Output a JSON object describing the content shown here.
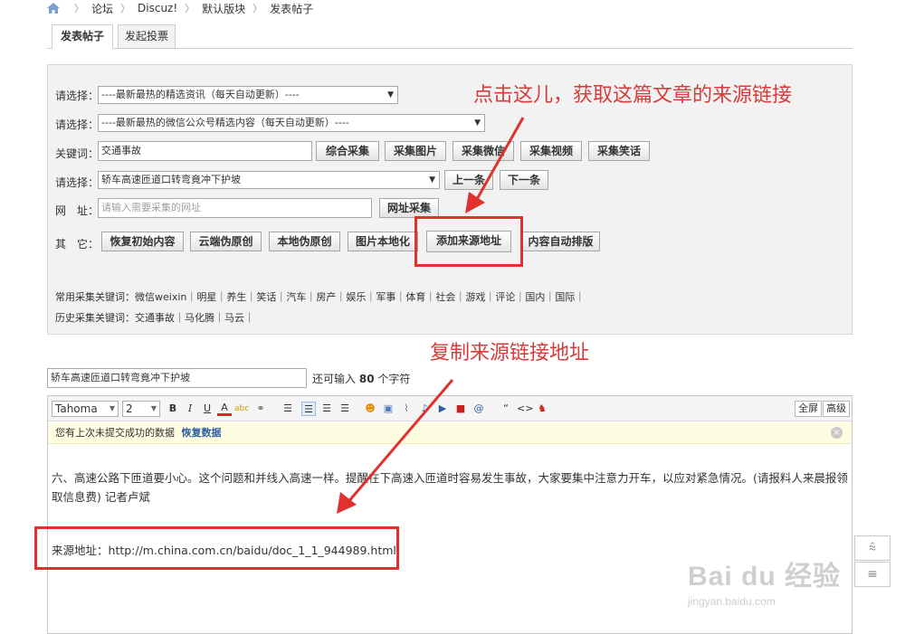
{
  "breadcrumb": {
    "items": [
      "论坛",
      "Discuz!",
      "默认版块",
      "发表帖子"
    ]
  },
  "tabs": [
    {
      "label": "发表帖子"
    },
    {
      "label": "发起投票"
    }
  ],
  "panel": {
    "row1": {
      "label": "请选择：",
      "value": "----最新最热的精选资讯（每天自动更新）----"
    },
    "row2": {
      "label": "请选择：",
      "value": "----最新最热的微信公众号精选内容（每天自动更新）----"
    },
    "row3": {
      "label": "关键词：",
      "value": "交通事故",
      "buttons": [
        "综合采集",
        "采集图片",
        "采集微信",
        "采集视频",
        "采集笑话"
      ]
    },
    "row4": {
      "label": "请选择：",
      "value": "轿车高速匝道口转弯竟冲下护坡",
      "buttons": [
        "上一条",
        "下一条"
      ]
    },
    "row5": {
      "label": "网　址：",
      "placeholder": "请输入需要采集的网址",
      "button": "网址采集"
    },
    "row6": {
      "label": "其　它：",
      "buttons": [
        "恢复初始内容",
        "云端伪原创",
        "本地伪原创",
        "图片本地化",
        "添加来源地址",
        "内容自动排版"
      ]
    },
    "keywords_common": "常用采集关键词：微信weixin｜明星｜养生｜笑话｜汽车｜房产｜娱乐｜军事｜体育｜社会｜游戏｜评论｜国内｜国际｜",
    "keywords_history": "历史采集关键词：交通事故｜马化腾｜马云｜"
  },
  "title": {
    "value": "轿车高速匝道口转弯竟冲下护坡",
    "count_prefix": "还可输入",
    "count_value": "80",
    "count_suffix": "个字符"
  },
  "editor": {
    "font": "Tahoma",
    "size": "2",
    "fullscreen": "全屏",
    "advanced": "高级",
    "notice_text": "您有上次未提交成功的数据",
    "notice_link": "恢复数据",
    "body": "六、高速公路下匝道要小心。这个问题和并线入高速一样。提醒在下高速入匝道时容易发生事故，大家要集中注意力开车，以应对紧急情况。(请报料人来晨报领取信息费) 记者卢斌",
    "source_label": "来源地址：",
    "source_url": "http://m.china.com.cn/baidu/doc_1_1_944989.html"
  },
  "annotations": {
    "top": "点击这儿，获取这篇文章的来源链接",
    "middle": "复制来源链接地址"
  },
  "watermark": {
    "brand": "Bai du 经验",
    "url": "jingyan.baidu.com"
  },
  "colors": {
    "annotation_red": "#d93a3a",
    "link_blue": "#2f5fa3"
  }
}
